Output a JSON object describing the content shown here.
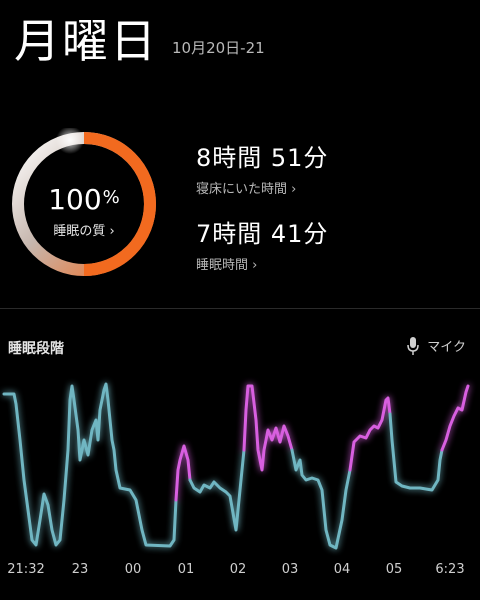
{
  "header": {
    "day": "月曜日",
    "date_range": "10月20日-21"
  },
  "score": {
    "value": "100",
    "unit": "%",
    "label": "睡眠の質 ›",
    "fraction": 1.0
  },
  "metrics": {
    "time_in_bed": {
      "value": "8時間 51分",
      "label": "寝床にいた時間 ›"
    },
    "time_asleep": {
      "value": "7時間 41分",
      "label": "睡眠時間 ›"
    }
  },
  "stages": {
    "title": "睡眠段階",
    "mic_label": "マイク"
  },
  "x_axis": [
    "21:32",
    "23",
    "00",
    "01",
    "02",
    "03",
    "04",
    "05",
    "6:23"
  ],
  "colors": {
    "ring_orange": "#f26a1f",
    "awake_line": "#6fb6c2",
    "rem_line": "#d85fe0",
    "bg": "#000000"
  }
}
